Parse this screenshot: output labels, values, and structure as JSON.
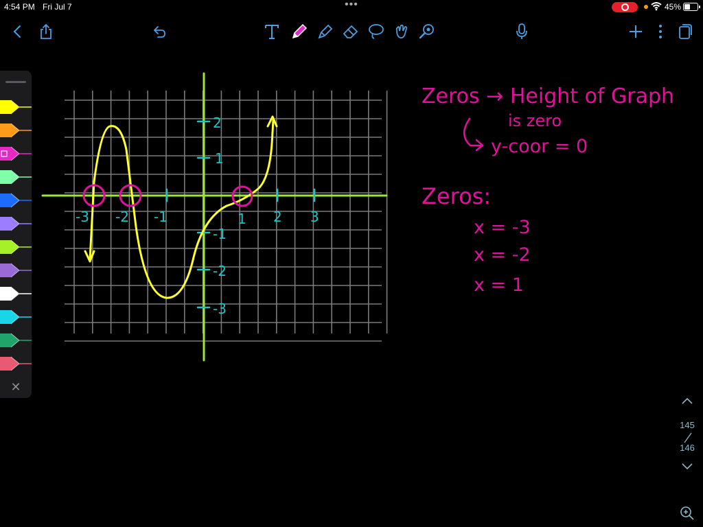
{
  "status_bar": {
    "time": "4:54 PM",
    "date": "Fri Jul 7",
    "battery_percent": "45%",
    "battery_level": 0.45,
    "recording": true
  },
  "toolbar": {
    "left": [
      "back-icon",
      "share-icon",
      "undo-icon"
    ],
    "tools": [
      "text-tool-icon",
      "pen-tool-icon",
      "highlighter-tool-icon",
      "eraser-tool-icon",
      "lasso-tool-icon",
      "shapes-tool-icon",
      "laser-pointer-icon"
    ],
    "right": [
      "microphone-icon",
      "add-page-icon",
      "more-options-icon",
      "pages-icon"
    ],
    "accent": "#4a9fe0"
  },
  "pen_palette": {
    "colors": [
      "#ffff00",
      "#ff9a1a",
      "#e628c4",
      "#7fffaa",
      "#1e6bff",
      "#9b7dff",
      "#a6f02a",
      "#9a6ad6",
      "#ffffff",
      "#1ad5e8",
      "#1fa56a",
      "#e85a72"
    ],
    "selected_index": 2
  },
  "notes": {
    "line1": "Zeros → Height of Graph",
    "line2": "is zero",
    "line3": "y-coor = 0",
    "zeros_title": "Zeros:",
    "zero1": "x = -3",
    "zero2": "x = -2",
    "zero3": "x = 1",
    "ink_color": "#e0119a"
  },
  "graph": {
    "x_tick_labels": [
      "-3",
      "-2",
      "-1",
      "1",
      "2",
      "3"
    ],
    "y_tick_labels": [
      "2",
      "1",
      "-1",
      "-2",
      "-3"
    ],
    "zeros_circled": [
      -3,
      -2,
      1
    ],
    "axis_color": "#9ee63a",
    "label_color": "#19c6c6",
    "curve_color": "#ffff33",
    "circle_color": "#e0119a"
  },
  "pager": {
    "current": "145",
    "total": "146"
  }
}
